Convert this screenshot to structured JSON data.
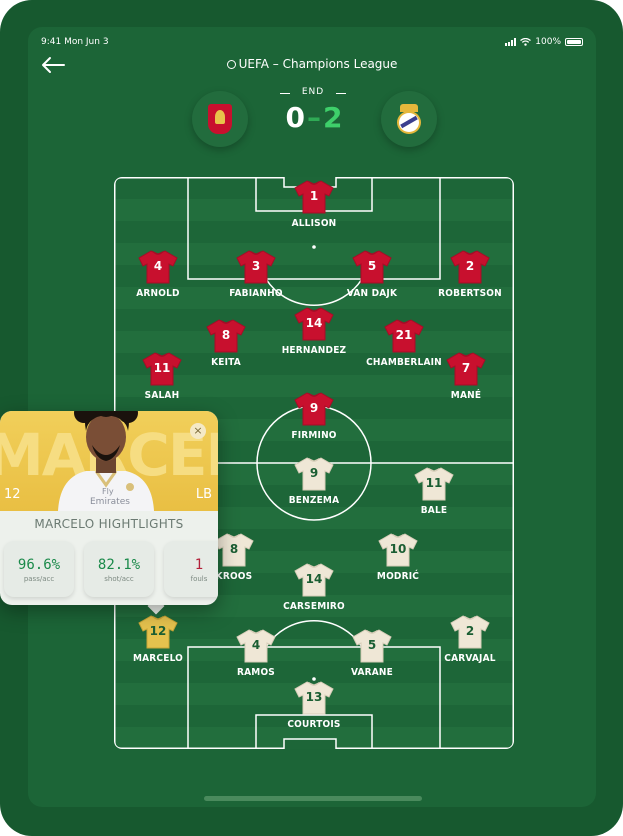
{
  "status_bar": {
    "time": "9:41  Mon Jun 3",
    "battery": "100%"
  },
  "header": {
    "league": "UEFA – Champions League"
  },
  "match": {
    "status": "END",
    "home_score": "0",
    "separator": "–",
    "away_score": "2"
  },
  "colors": {
    "home_kit": "#c8102e",
    "away_kit": "#efe7d6",
    "keeper_kit": "#e5c24e",
    "pitch": "#1d6638"
  },
  "players": [
    {
      "name": "ALLISON",
      "number": "1",
      "kit": "red"
    },
    {
      "name": "ARNOLD",
      "number": "4",
      "kit": "red"
    },
    {
      "name": "FABIANHO",
      "number": "3",
      "kit": "red"
    },
    {
      "name": "VAN DAJK",
      "number": "5",
      "kit": "red"
    },
    {
      "name": "ROBERTSON",
      "number": "2",
      "kit": "red"
    },
    {
      "name": "KEITA",
      "number": "8",
      "kit": "red"
    },
    {
      "name": "HERNANDEZ",
      "number": "14",
      "kit": "red"
    },
    {
      "name": "CHAMBERLAIN",
      "number": "21",
      "kit": "red"
    },
    {
      "name": "SALAH",
      "number": "11",
      "kit": "red"
    },
    {
      "name": "MANÉ",
      "number": "7",
      "kit": "red"
    },
    {
      "name": "FIRMINO",
      "number": "9",
      "kit": "red"
    },
    {
      "name": "BENZEMA",
      "number": "9",
      "kit": "cream"
    },
    {
      "name": "BALE",
      "number": "11",
      "kit": "cream"
    },
    {
      "name": "KROOS",
      "number": "8",
      "kit": "cream"
    },
    {
      "name": "MODRIĆ",
      "number": "10",
      "kit": "cream"
    },
    {
      "name": "CARSEMIRO",
      "number": "14",
      "kit": "cream"
    },
    {
      "name": "MARCELO",
      "number": "12",
      "kit": "gold"
    },
    {
      "name": "RAMOS",
      "number": "4",
      "kit": "cream"
    },
    {
      "name": "VARANE",
      "number": "5",
      "kit": "cream"
    },
    {
      "name": "CARVAJAL",
      "number": "2",
      "kit": "cream"
    },
    {
      "name": "COURTOIS",
      "number": "13",
      "kit": "cream"
    }
  ],
  "player_card": {
    "bg_name": "MARCELO",
    "number": "12",
    "position": "LB",
    "title": "MARCELO HIGHTLIGHTS",
    "stats": [
      {
        "value": "96.6%",
        "label": "pass/acc"
      },
      {
        "value": "82.1%",
        "label": "shot/acc"
      },
      {
        "value": "1",
        "label": "fouls"
      }
    ]
  }
}
